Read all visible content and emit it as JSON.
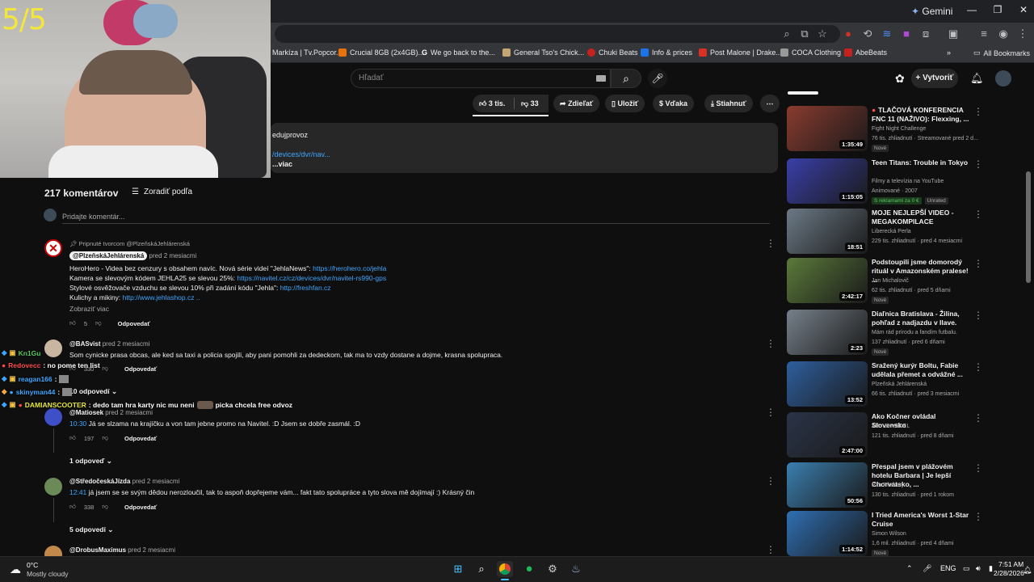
{
  "browser": {
    "gemini_label": "Gemini",
    "bookmarks": [
      {
        "label": "Markíza | Tv.Popcor...",
        "color": "#d93025"
      },
      {
        "label": "Crucial 8GB (2x4GB)...",
        "color": "#e8710a"
      },
      {
        "label": "We go back to the...",
        "color": "#ffffff"
      },
      {
        "label": "General Tso's Chick...",
        "color": "#c5a572"
      },
      {
        "label": "Chuki Beats",
        "color": "#c5221f"
      },
      {
        "label": "Info & prices",
        "color": "#1a73e8"
      },
      {
        "label": "Post Malone | Drake...",
        "color": "#d93025"
      },
      {
        "label": "COCA Clothing",
        "color": "#999999"
      },
      {
        "label": "AbeBeats",
        "color": "#c5221f"
      }
    ],
    "all_bookmarks": "All Bookmarks"
  },
  "webcam": {
    "counter": "5/5"
  },
  "youtube": {
    "search_placeholder": "Hľadať",
    "create_label": "Vytvoriť",
    "likes": "3 tis.",
    "dislikes": "33",
    "share": "Zdieľať",
    "save": "Uložiť",
    "thanks": "Vďaka",
    "download": "Stiahnuť",
    "desc_line1": "edujprovoz",
    "desc_link": "/devices/dvr/nav...",
    "desc_more": "...viac"
  },
  "comments": {
    "count": "217 komentárov",
    "sort": "Zoradiť podľa",
    "add_placeholder": "Pridajte komentár...",
    "pinned_label": "Pripnuté tvorcom @PlzeňskáJehlárenská",
    "pinned_author": "@PlzeňskáJehlárenská",
    "pinned_time": "pred 2 mesiacmi",
    "pinned_lines": [
      {
        "text": "HeroHero - Videa bez cenzury s obsahem navíc. Nová série videí \"JehlaNews\": ",
        "link": "https://herohero.co/jehla"
      },
      {
        "text": "Kamera se slevovým kódem JEHLA25 se slevou 25%: ",
        "link": "https://navitel.cz/cz/devices/dvr/navitel-rs990-gps"
      },
      {
        "text": "Stylové osvěžovače vzduchu se slevou 10% při zadání kódu \"Jehla\": ",
        "link": "http://freshfan.cz"
      },
      {
        "text": "Kulichy a mikiny: ",
        "link": "http://www.jehlashop.cz .."
      }
    ],
    "pinned_more": "Zobraziť viac",
    "pinned_likes": "5",
    "reply_label": "Odpovedať",
    "c1_author": "@BASvist",
    "c1_time": "pred 2 mesiacmi",
    "c1_text": "Som cynicke prasa obcas, ale ked sa taxi a policia spojili, aby pani pomohli za dedeckom, tak ma to vzdy dostane a dojme, krasna spolupraca.",
    "c1_likes": "330",
    "c1_replies": "10 odpovedí",
    "c2_author": "@Matiosek",
    "c2_time": "pred 2 mesiacmi",
    "c2_ts": "10:30",
    "c2_text": " Já se slzama na krajíčku a von tam jebne promo na Navitel. :D Jsem se dobře zasmál. :D",
    "c2_likes": "197",
    "c2_replies": "1 odpoveď",
    "c3_author": "@StředočeskáJízda",
    "c3_time": "pred 2 mesiacmi",
    "c3_ts": "12:41",
    "c3_text": " já jsem se se svým dědou nerozloučil, tak to aspoň dopřejeme vám... fakt tato spolupráce a tyto slova mě dojímají :) Krásný čin",
    "c3_likes": "338",
    "c3_replies": "5 odpovedí",
    "c4_author": "@DrobusMaximus",
    "c4_time": "pred 2 mesiacmi"
  },
  "chat": [
    {
      "user": "Kn1Gu",
      "color": "#54c65b",
      "msg": ""
    },
    {
      "user": "Redovecc",
      "color": "#ff4a4a",
      "msg": ": no pome ten list"
    },
    {
      "user": "reagan166",
      "color": "#3ea6ff",
      "msg": ":"
    },
    {
      "user": "skinyman44",
      "color": "#3ea6ff",
      "msg": ":"
    },
    {
      "user": "DAMIANSCOOTER",
      "color": "#e8e83a",
      "msg": ": dedo tam hra karty nic mu neni",
      "msg2": "picka chcela free odvoz"
    }
  ],
  "related": [
    {
      "title": "TLAČOVÁ KONFERENCIA FNC 11 (NAŽIVO): Flexxing, ...",
      "channel": "Fight Night Challenge",
      "meta": "76 tis. zhliadnutí · Streamované pred 2 d...",
      "badge": "Nové",
      "duration": "1:35:49",
      "thumb": "#8a3b2e",
      "live": true
    },
    {
      "title": "Teen Titans: Trouble in Tokyo",
      "channel": "Filmy a televízia na YouTube",
      "meta": "Animované · 2007",
      "badge": "S reklamami za 0 €",
      "badge2": "Unrated",
      "duration": "1:15:05",
      "thumb": "#3a3fa8"
    },
    {
      "title": "MOJE NEJLEPŠÍ VIDEO - MEGAKOMPILACE",
      "channel": "Liberecká Perla",
      "meta": "229 tis. zhliadnutí · pred 4 mesiacmi",
      "duration": "18:51",
      "thumb": "#6c7a86"
    },
    {
      "title": "Podstoupili jsme domorodý rituál v Amazonském pralese! ...",
      "channel": "Jan Michalovič",
      "meta": "62 tis. zhliadnutí · pred 5 dňami",
      "badge": "Nové",
      "duration": "2:42:17",
      "thumb": "#5b7a3a"
    },
    {
      "title": "Diaľnica Bratislava - Žilina, pohľad z nadjazdu v Ilave.",
      "channel": "Mám rád prírodu a fandím futbalu.",
      "meta": "137 zhliadnutí · pred 6 dňami",
      "badge": "Nové",
      "duration": "2:23",
      "thumb": "#76808a"
    },
    {
      "title": "Sražený kurýr Boltu, Fabie udělala přemet a odvážné ...",
      "channel": "Plzeňská Jehlárenská",
      "meta": "66 tis. zhliadnutí · pred 3 mesiacmi",
      "duration": "13:52",
      "thumb": "#2e5f9e"
    },
    {
      "title": "Ako Kočner ovládal Slovensko",
      "channel": "ABY SI VEDEL",
      "meta": "121 tis. zhliadnutí · pred 8 dňami",
      "duration": "2:47:00",
      "thumb": "#2a3448"
    },
    {
      "title": "Přespal jsem v plážovém hotelu Barbara | Je lepší Chorvatsko, ...",
      "channel": "Pan Přešaný",
      "meta": "130 tis. zhliadnutí · pred 1 rokom",
      "duration": "50:56",
      "thumb": "#3b7fb0"
    },
    {
      "title": "I Tried America's Worst 1-Star Cruise",
      "channel": "Simon Wilson",
      "meta": "1,6 mil. zhliadnutí · pred 4 dňami",
      "badge": "Nové",
      "duration": "1:14:52",
      "thumb": "#2f6fb3"
    }
  ],
  "taskbar": {
    "temp": "0°C",
    "weather": "Mostly cloudy",
    "lang": "ENG",
    "time": "7:51 AM",
    "date": "2/28/2026"
  }
}
